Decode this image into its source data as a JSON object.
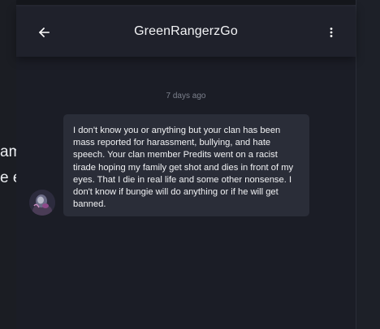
{
  "background_texts": [
    "am",
    "e e"
  ],
  "header": {
    "title": "GreenRangerzGo",
    "back_icon": "arrow-left-icon",
    "menu_icon": "more-vertical-icon"
  },
  "conversation": {
    "timestamp": "7 days ago",
    "messages": [
      {
        "text": "I don't know you or anything but your clan has been mass reported for harassment, bullying, and hate speech. Your clan member Predits went on a racist tirade hoping my family get shot and dies in front of my eyes. That I die in real life and some other nonsense. I don't know if bungie will do anything or if he will get banned."
      }
    ]
  },
  "colors": {
    "panel_bg": "#1b1d26",
    "header_bg": "#1f212b",
    "bubble_bg": "#2a2d38",
    "text": "#f1f2f4",
    "muted": "#7c808c"
  }
}
